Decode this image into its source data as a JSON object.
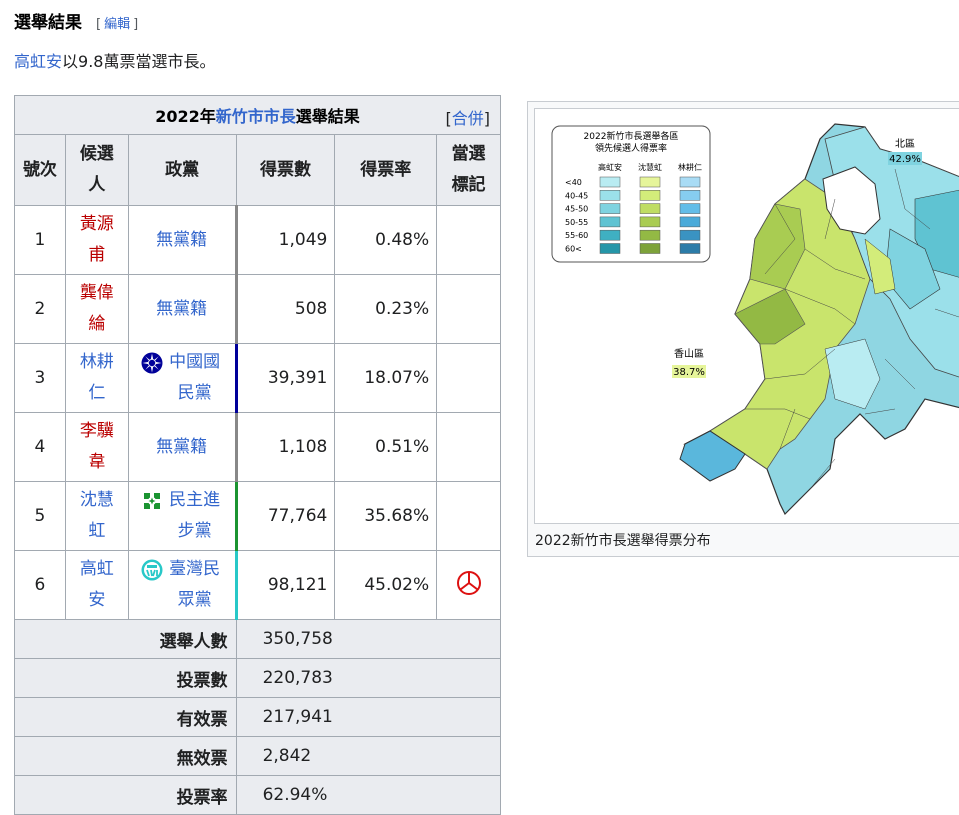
{
  "section": {
    "title": "選舉結果",
    "edit_open": "[",
    "edit": "編輯",
    "edit_close": "]"
  },
  "lead": {
    "link": "高虹安",
    "text": "以9.8萬票當選市長。"
  },
  "table": {
    "caption_year": "2022年",
    "caption_link": "新竹市市長",
    "caption_rest": "選舉結果",
    "merge_open": "[",
    "merge": "合併",
    "merge_close": "]",
    "headers": [
      "號次",
      "候選人",
      "政黨",
      "得票數",
      "得票率",
      "當選標記"
    ],
    "rows": [
      {
        "no": "1",
        "name": "黃源甫",
        "party": "無黨籍",
        "votes": "1,049",
        "pct": "0.48%"
      },
      {
        "no": "2",
        "name": "龔偉綸",
        "party": "無黨籍",
        "votes": "508",
        "pct": "0.23%"
      },
      {
        "no": "3",
        "name": "林耕仁",
        "party": "中國國民黨",
        "votes": "39,391",
        "pct": "18.07%"
      },
      {
        "no": "4",
        "name": "李驥韋",
        "party": "無黨籍",
        "votes": "1,108",
        "pct": "0.51%"
      },
      {
        "no": "5",
        "name": "沈慧虹",
        "party": "民主進步黨",
        "votes": "77,764",
        "pct": "35.68%"
      },
      {
        "no": "6",
        "name": "高虹安",
        "party": "臺灣民眾黨",
        "votes": "98,121",
        "pct": "45.02%"
      }
    ],
    "summary": [
      {
        "label": "選舉人數",
        "value": "350,758"
      },
      {
        "label": "投票數",
        "value": "220,783"
      },
      {
        "label": "有效票",
        "value": "217,941"
      },
      {
        "label": "無效票",
        "value": "2,842"
      },
      {
        "label": "投票率",
        "value": "62.94%"
      }
    ]
  },
  "map": {
    "caption": "2022新竹市長選舉得票分布",
    "legend_title1": "2022新竹市長選舉各區",
    "legend_title2": "領先候選人得票率",
    "legend_cols": [
      "高虹安",
      "沈慧虹",
      "林耕仁"
    ],
    "legend_rows": [
      "<40",
      "40-45",
      "45-50",
      "50-55",
      "55-60",
      "60<"
    ],
    "label_north": "北區",
    "label_north_pct": "42.9%",
    "label_xiangshan": "香山區",
    "label_xiangshan_pct": "38.7%",
    "colors": {
      "kao": [
        "#b9ecf2",
        "#9be0ea",
        "#7fd3e0",
        "#5fc3d2",
        "#3fb0c2",
        "#2596a8"
      ],
      "shen": [
        "#e6f59a",
        "#d3ec7a",
        "#bfdd63",
        "#a9cc52",
        "#93b944",
        "#7da23a"
      ],
      "lin": [
        "#a9dcf5",
        "#86cdf0",
        "#63bde8",
        "#4aaad9",
        "#3a93c2",
        "#2c7ca8"
      ]
    }
  }
}
